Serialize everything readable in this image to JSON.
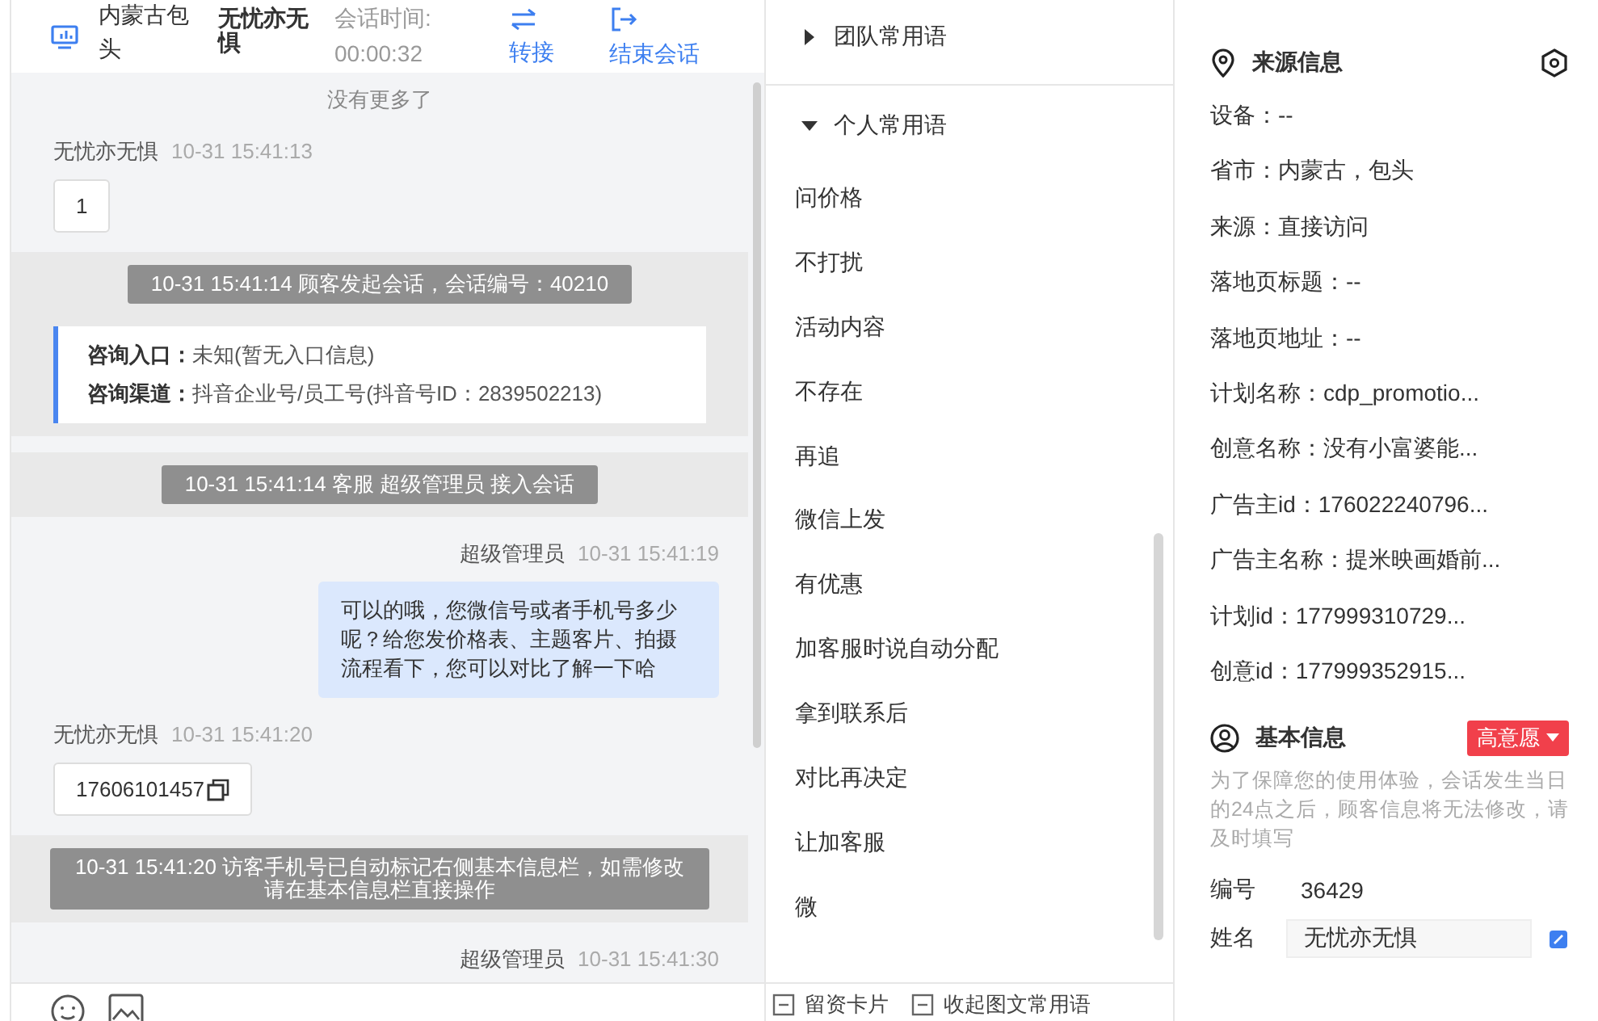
{
  "header": {
    "location": "内蒙古包头",
    "visitor": "无忧亦无惧",
    "timer_label": "会话时间:",
    "timer_value": "00:00:32",
    "actions": [
      {
        "kind": "transfer",
        "label": "转接"
      },
      {
        "kind": "end",
        "label": "结束会话"
      }
    ]
  },
  "chat": {
    "notice": "没有更多了",
    "messages": [
      {
        "kind": "visitor",
        "sender": "无忧亦无惧",
        "time": "10-31 15:41:13",
        "text": "1"
      },
      {
        "kind": "system",
        "text": "10-31 15:41:14 顾客发起会话，会话编号：40210"
      },
      {
        "kind": "entry",
        "lines": [
          {
            "label": "咨询入口：",
            "value": "未知(暂无入口信息)"
          },
          {
            "label": "咨询渠道：",
            "value": "抖音企业号/员工号(抖音号ID：2839502213)"
          }
        ]
      },
      {
        "kind": "system",
        "text": "10-31 15:41:14 客服 超级管理员 接入会话"
      },
      {
        "kind": "agent",
        "sender": "超级管理员",
        "time": "10-31 15:41:19",
        "text": "可以的哦，您微信号或者手机号多少呢？给您发价格表、主题客片、拍摄流程看下，您可以对比了解一下哈"
      },
      {
        "kind": "phone",
        "sender": "无忧亦无惧",
        "time": "10-31 15:41:20",
        "text": "17606101457"
      },
      {
        "kind": "system",
        "text": "10-31 15:41:20 访客手机号已自动标记右侧基本信息栏，如需修改请在基本信息栏直接操作"
      },
      {
        "kind": "agent",
        "sender": "超级管理员",
        "time": "10-31 15:41:30"
      }
    ]
  },
  "phrases": {
    "groups": [
      {
        "title": "团队常用语",
        "expanded": false
      },
      {
        "title": "个人常用语",
        "expanded": true,
        "items": [
          "问价格",
          "不打扰",
          "活动内容",
          "不存在",
          "再追",
          "微信上发",
          "有优惠",
          "加客服时说自动分配",
          "拿到联系后",
          "对比再决定",
          "让加客服",
          "微"
        ]
      }
    ],
    "footer_actions": [
      "留资卡片",
      "收起图文常用语"
    ]
  },
  "source_info": {
    "title": "来源信息",
    "lines": [
      "设备：--",
      "省市：内蒙古，包头",
      "来源：直接访问",
      "落地页标题：--",
      "落地页地址：--",
      "计划名称：cdp_promotio...",
      "创意名称：没有小富婆能...",
      "广告主id：176022240796...",
      "广告主名称：提米映画婚前...",
      "计划id：177999310729...",
      "创意id：177999352915..."
    ]
  },
  "basic_info": {
    "title": "基本信息",
    "tag": "高意愿",
    "note": "为了保障您的使用体验，会话发生当日的24点之后，顾客信息将无法修改，请及时填写",
    "fields": [
      {
        "kind": "text",
        "label": "编号",
        "value": "36429"
      },
      {
        "kind": "input",
        "label": "姓名",
        "value": "无忧亦无惧"
      }
    ]
  }
}
